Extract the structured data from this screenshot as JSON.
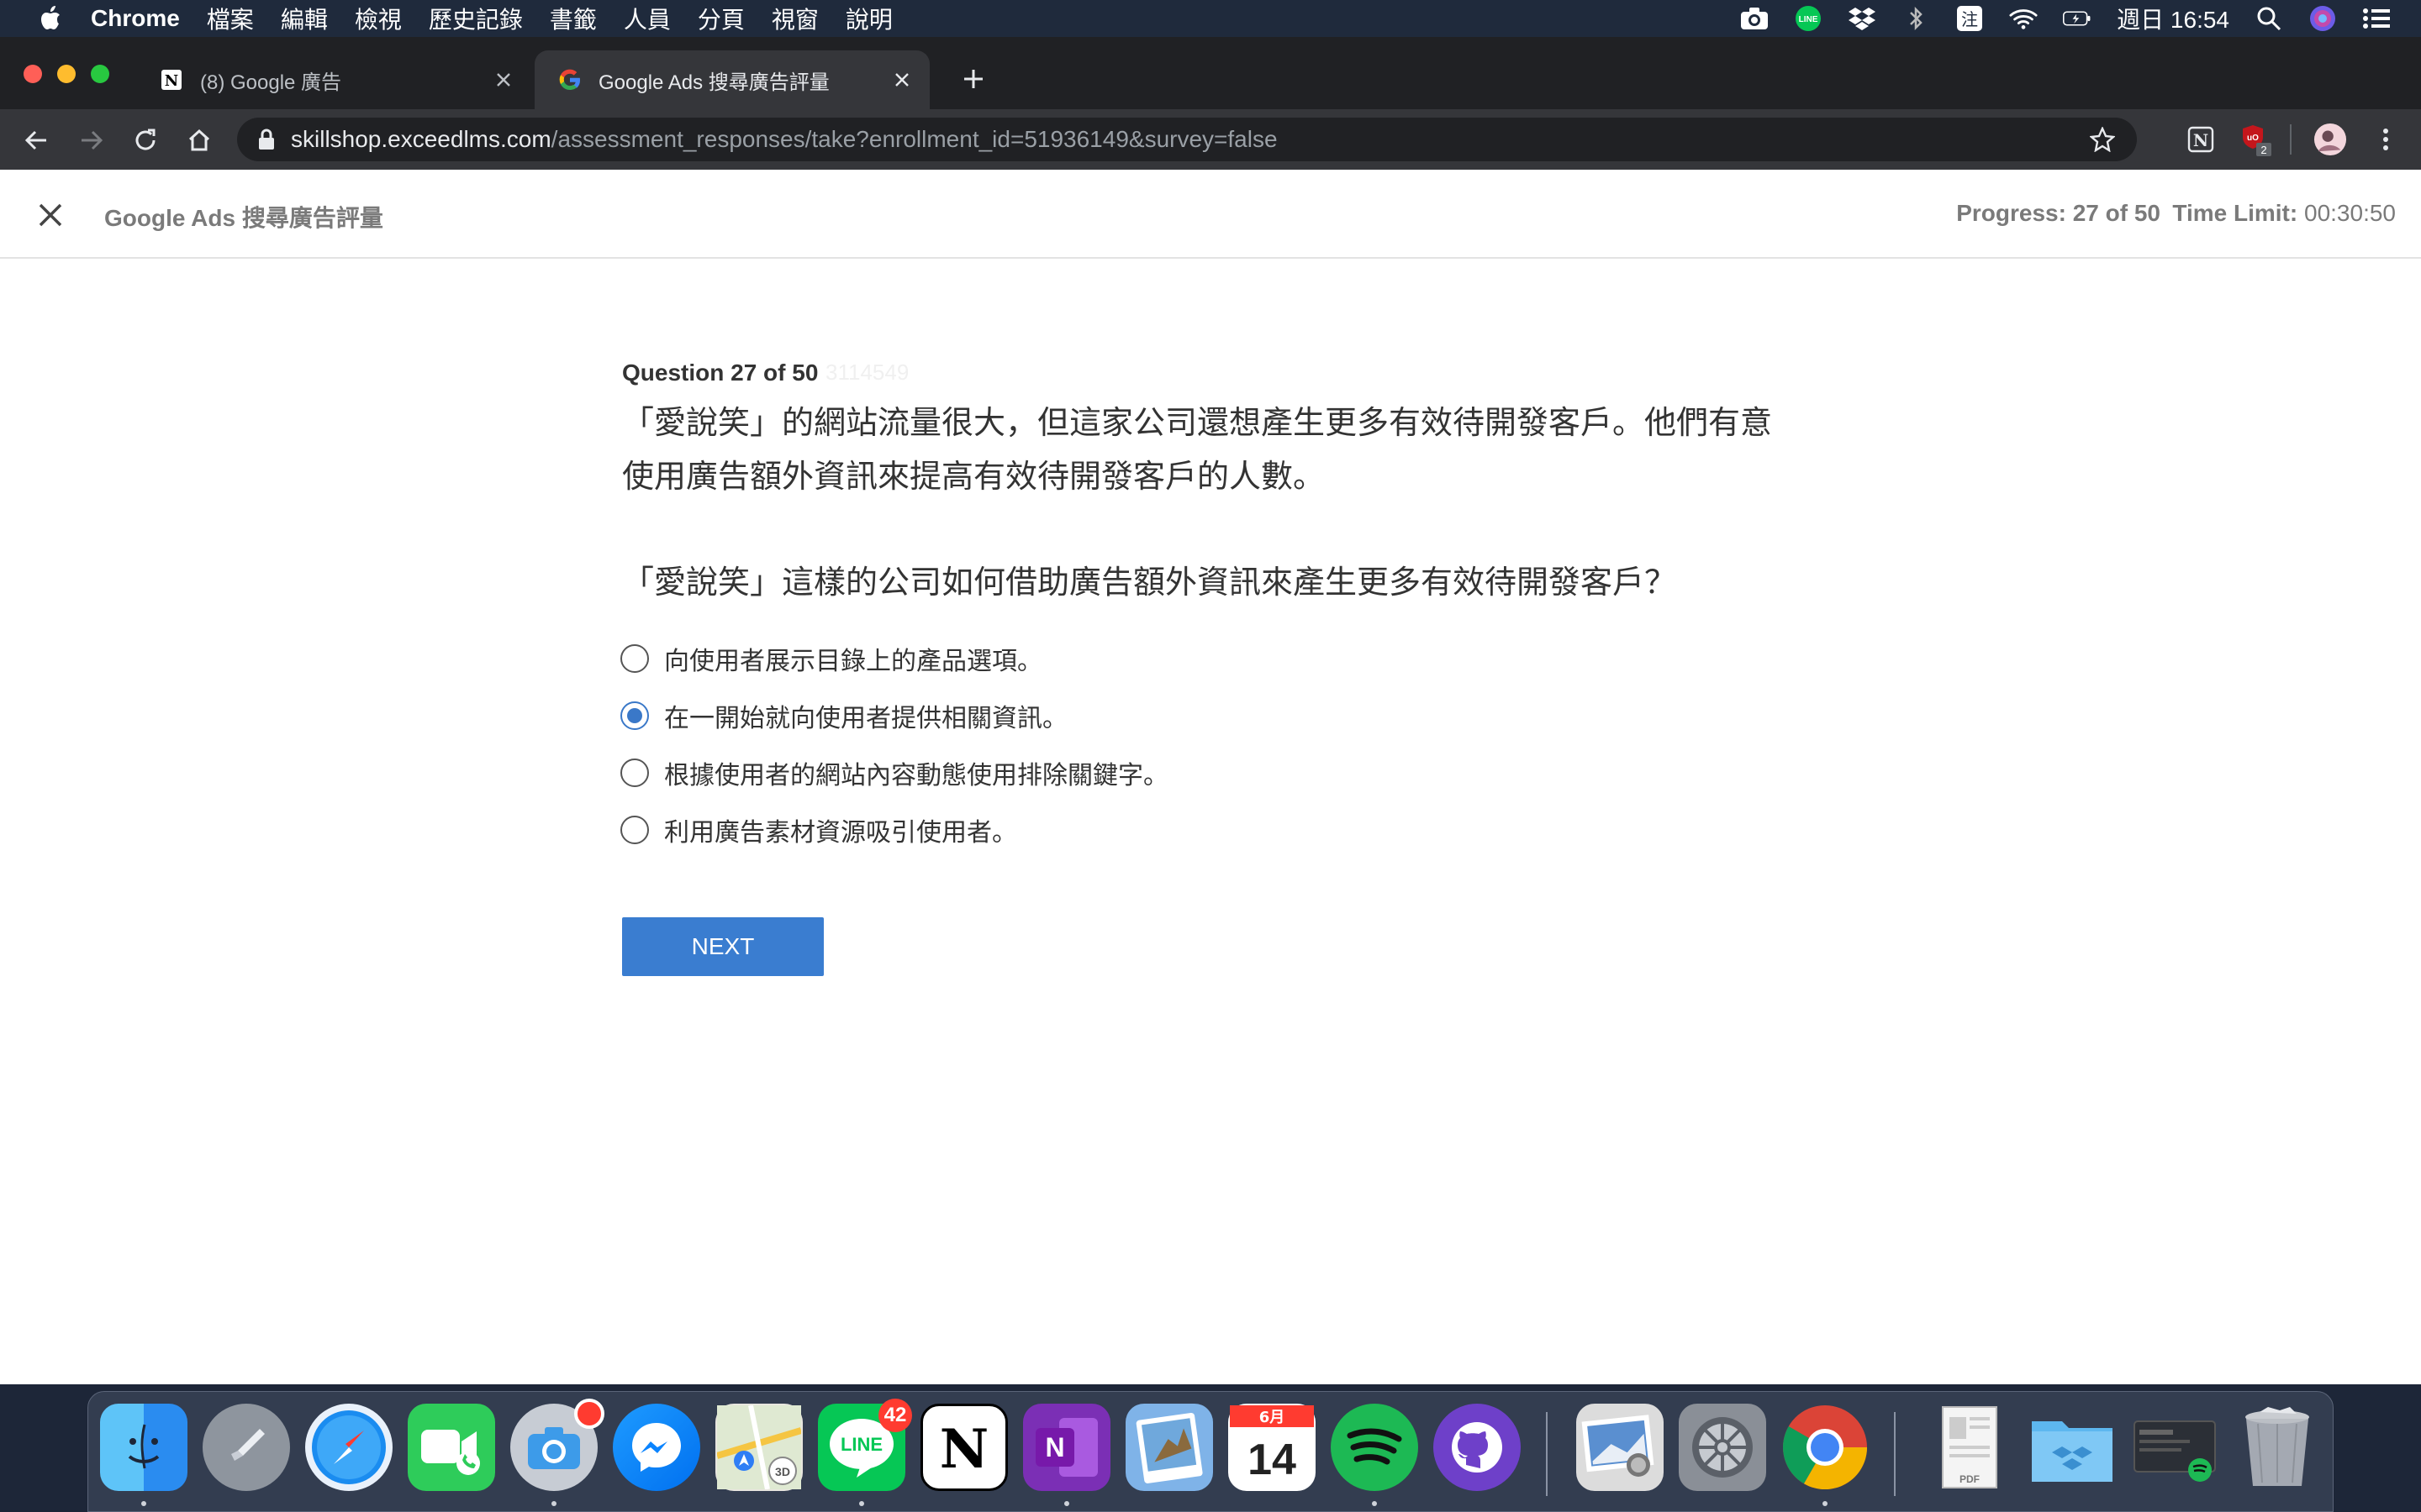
{
  "menubar": {
    "app": "Chrome",
    "items": [
      "檔案",
      "編輯",
      "檢視",
      "歷史記錄",
      "書籤",
      "人員",
      "分頁",
      "視窗",
      "說明"
    ],
    "clock": "週日 16:54",
    "status_icons": [
      "camera-icon",
      "line-icon",
      "dropbox-icon",
      "bluetooth-icon",
      "input-method-icon",
      "wifi-icon",
      "battery-icon",
      "spotlight-icon",
      "siri-icon",
      "control-center-icon"
    ],
    "input_method": "注"
  },
  "browser": {
    "tabs": [
      {
        "title": "(8) Google 廣告",
        "icon": "notion-icon",
        "active": false
      },
      {
        "title": "Google Ads 搜尋廣告評量",
        "icon": "google-icon",
        "active": true
      }
    ],
    "url_host": "skillshop.exceedlms.com",
    "url_path": "/assessment_responses/take?enrollment_id=51936149&survey=false",
    "extension_badge": "2"
  },
  "header": {
    "course_title": "Google Ads 搜尋廣告評量",
    "progress": "Progress: 27 of 50",
    "time_limit_label": "Time Limit:",
    "time_limit_value": "00:30:50"
  },
  "question": {
    "number": "Question 27 of 50",
    "id": "3114549",
    "line1": "「愛說笑」的網站流量很大，但這家公司還想產生更多有效待開發客戶。他們有意",
    "line2": "使用廣告額外資訊來提高有效待開發客戶的人數。",
    "prompt": "「愛說笑」這樣的公司如何借助廣告額外資訊來產生更多有效待開發客戶？",
    "options": [
      {
        "label": "向使用者展示目錄上的產品選項。",
        "selected": false
      },
      {
        "label": "在一開始就向使用者提供相關資訊。",
        "selected": true
      },
      {
        "label": "根據使用者的網站內容動態使用排除關鍵字。",
        "selected": false
      },
      {
        "label": "利用廣告素材資源吸引使用者。",
        "selected": false
      }
    ],
    "next_label": "NEXT"
  },
  "dock": {
    "apps": [
      "finder-icon",
      "launchpad-icon",
      "safari-icon",
      "facetime-icon",
      "screenshot-icon",
      "messenger-icon",
      "maps-icon",
      "line-icon",
      "notion-icon",
      "onenote-icon",
      "preview-icon",
      "calendar-icon",
      "spotify-icon",
      "github-desktop-icon",
      "photos-icon",
      "system-preferences-icon",
      "chrome-icon",
      "pdf-document-icon",
      "dropbox-folder-icon",
      "activity-window-icon",
      "trash-icon"
    ],
    "line_badge": "42",
    "calendar_month": "6月",
    "calendar_day": "14",
    "pdf_label": "PDF"
  },
  "colors": {
    "accent": "#3a7dd0",
    "menubar": "#1f2a3c",
    "tabstrip": "#202124",
    "toolbar": "#35363a"
  }
}
